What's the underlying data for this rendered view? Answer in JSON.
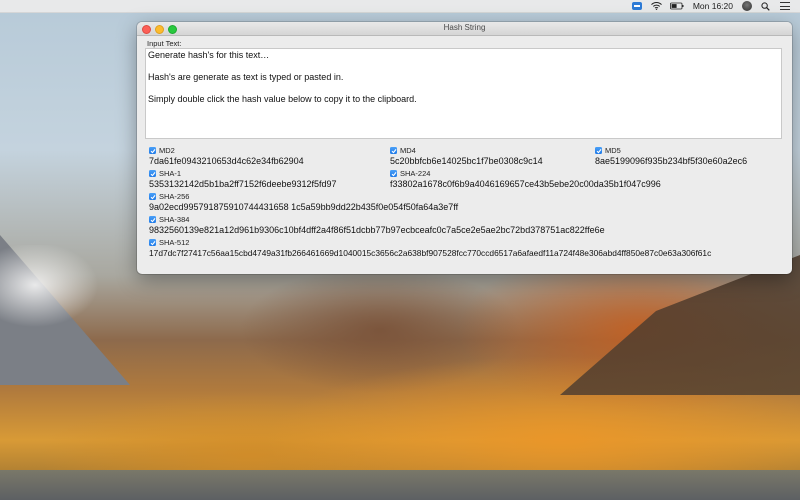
{
  "menubar": {
    "clock": "Mon 16:20",
    "icons": [
      "teamviewer-icon",
      "wifi-icon",
      "battery-icon",
      "user-avatar",
      "search-icon",
      "menu-list-icon"
    ]
  },
  "window": {
    "title": "Hash String",
    "input_label": "Input Text:",
    "input_lines": [
      "Generate hash's for this text…",
      "Hash's are generate as text is typed or pasted in.",
      "Simply double click the hash value below to copy it to the clipboard."
    ]
  },
  "hashes": {
    "md2": {
      "label": "MD2",
      "checked": true,
      "value": "7da61fe0943210653d4c62e34fb62904"
    },
    "md4": {
      "label": "MD4",
      "checked": true,
      "value": "5c20bbfcb6e14025bc1f7be0308c9c14"
    },
    "md5": {
      "label": "MD5",
      "checked": true,
      "value": "8ae5199096f935b234bf5f30e60a2ec6"
    },
    "sha1": {
      "label": "SHA-1",
      "checked": true,
      "value": "5353132142d5b1ba2ff7152f6deebe9312f5fd97"
    },
    "sha224": {
      "label": "SHA-224",
      "checked": true,
      "value": "f33802a1678c0f6b9a4046169657ce43b5ebe20c00da35b1f047c996"
    },
    "sha256": {
      "label": "SHA-256",
      "checked": true,
      "value": "9a02ecd995791875910744431658 1c5a59bb9dd22b435f0e054f50fa64a3e7ff"
    },
    "sha384": {
      "label": "SHA-384",
      "checked": true,
      "value": "9832560139e821a12d961b9306c10bf4dff2a4f86f51dcbb77b97ecbceafc0c7a5ce2e5ae2bc72bd378751ac822ffe6e"
    },
    "sha512": {
      "label": "SHA-512",
      "checked": true,
      "value": "17d7dc7f27417c56aa15cbd4749a31fb266461669d1040015c3656c2a638bf907528fcc770ccd6517a6afaedf11a724f48e306abd4ff850e87c0e63a306f61c"
    }
  },
  "colors": {
    "checkbox": "#1f7ae8",
    "close": "#fc5f57",
    "minimize": "#fdbb2e",
    "zoom": "#29c93f"
  }
}
